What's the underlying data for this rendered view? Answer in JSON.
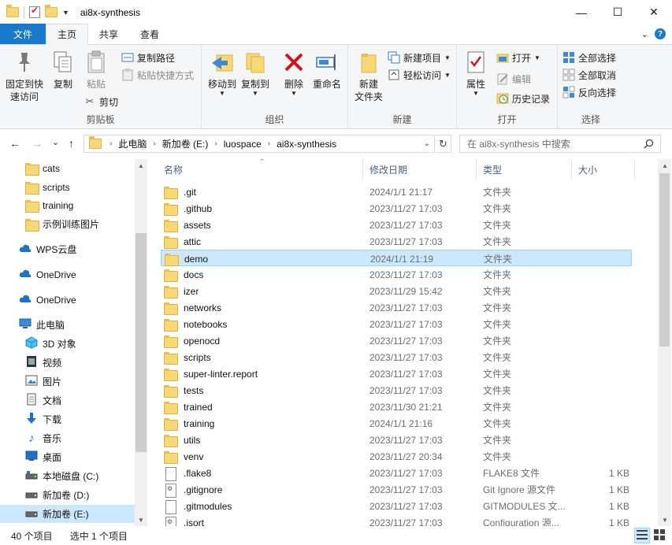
{
  "window": {
    "title": "ai8x-synthesis",
    "minimize": "—",
    "maximize": "☐",
    "close": "✕"
  },
  "ribbon_tabs": {
    "file": "文件",
    "home": "主页",
    "share": "共享",
    "view": "查看"
  },
  "ribbon": {
    "clipboard": {
      "label": "剪贴板",
      "pin_line1": "固定到快",
      "pin_line2": "速访问",
      "copy": "复制",
      "paste": "粘贴",
      "copy_path": "复制路径",
      "paste_shortcut": "粘贴快捷方式",
      "cut": "剪切"
    },
    "organize": {
      "label": "组织",
      "move_to": "移动到",
      "copy_to": "复制到",
      "delete": "删除",
      "rename": "重命名"
    },
    "new": {
      "label": "新建",
      "new_folder_line1": "新建",
      "new_folder_line2": "文件夹",
      "new_item": "新建项目",
      "easy_access": "轻松访问"
    },
    "open": {
      "label": "打开",
      "properties": "属性",
      "open": "打开",
      "edit": "编辑",
      "history": "历史记录"
    },
    "select": {
      "label": "选择",
      "select_all": "全部选择",
      "select_none": "全部取消",
      "invert": "反向选择"
    }
  },
  "address": {
    "back": "←",
    "forward": "→",
    "recent": "⌄",
    "up": "↑",
    "crumbs": [
      "此电脑",
      "新加卷 (E:)",
      "luospace",
      "ai8x-synthesis"
    ],
    "search_placeholder": "在 ai8x-synthesis 中搜索"
  },
  "nav": {
    "items": [
      {
        "label": "cats",
        "icon": "folder-icon"
      },
      {
        "label": "scripts",
        "icon": "folder-icon"
      },
      {
        "label": "training",
        "icon": "folder-icon"
      },
      {
        "label": "示例训练图片",
        "icon": "folder-icon"
      },
      {
        "label": "WPS云盘",
        "icon": "cloud-icon"
      },
      {
        "label": "OneDrive",
        "icon": "cloud-icon"
      },
      {
        "label": "OneDrive",
        "icon": "cloud-icon"
      },
      {
        "label": "此电脑",
        "icon": "computer-icon"
      },
      {
        "label": "3D 对象",
        "icon": "cube-icon"
      },
      {
        "label": "视频",
        "icon": "video-icon"
      },
      {
        "label": "图片",
        "icon": "picture-icon"
      },
      {
        "label": "文档",
        "icon": "document-icon"
      },
      {
        "label": "下载",
        "icon": "download-icon"
      },
      {
        "label": "音乐",
        "icon": "music-icon"
      },
      {
        "label": "桌面",
        "icon": "desktop-icon"
      },
      {
        "label": "本地磁盘 (C:)",
        "icon": "drive-icon"
      },
      {
        "label": "新加卷 (D:)",
        "icon": "drive-icon"
      },
      {
        "label": "新加卷 (E:)",
        "icon": "drive-icon"
      }
    ]
  },
  "columns": {
    "name": "名称",
    "date": "修改日期",
    "type": "类型",
    "size": "大小"
  },
  "files": [
    {
      "name": ".git",
      "date": "2024/1/1 21:17",
      "type": "文件夹",
      "size": "",
      "kind": "folder"
    },
    {
      "name": ".github",
      "date": "2023/11/27 17:03",
      "type": "文件夹",
      "size": "",
      "kind": "folder"
    },
    {
      "name": "assets",
      "date": "2023/11/27 17:03",
      "type": "文件夹",
      "size": "",
      "kind": "folder"
    },
    {
      "name": "attic",
      "date": "2023/11/27 17:03",
      "type": "文件夹",
      "size": "",
      "kind": "folder"
    },
    {
      "name": "demo",
      "date": "2024/1/1 21:19",
      "type": "文件夹",
      "size": "",
      "kind": "folder"
    },
    {
      "name": "docs",
      "date": "2023/11/27 17:03",
      "type": "文件夹",
      "size": "",
      "kind": "folder"
    },
    {
      "name": "izer",
      "date": "2023/11/29 15:42",
      "type": "文件夹",
      "size": "",
      "kind": "folder"
    },
    {
      "name": "networks",
      "date": "2023/11/27 17:03",
      "type": "文件夹",
      "size": "",
      "kind": "folder"
    },
    {
      "name": "notebooks",
      "date": "2023/11/27 17:03",
      "type": "文件夹",
      "size": "",
      "kind": "folder"
    },
    {
      "name": "openocd",
      "date": "2023/11/27 17:03",
      "type": "文件夹",
      "size": "",
      "kind": "folder"
    },
    {
      "name": "scripts",
      "date": "2023/11/27 17:03",
      "type": "文件夹",
      "size": "",
      "kind": "folder"
    },
    {
      "name": "super-linter.report",
      "date": "2023/11/27 17:03",
      "type": "文件夹",
      "size": "",
      "kind": "folder"
    },
    {
      "name": "tests",
      "date": "2023/11/27 17:03",
      "type": "文件夹",
      "size": "",
      "kind": "folder"
    },
    {
      "name": "trained",
      "date": "2023/11/30 21:21",
      "type": "文件夹",
      "size": "",
      "kind": "folder"
    },
    {
      "name": "training",
      "date": "2024/1/1 21:16",
      "type": "文件夹",
      "size": "",
      "kind": "folder"
    },
    {
      "name": "utils",
      "date": "2023/11/27 17:03",
      "type": "文件夹",
      "size": "",
      "kind": "folder"
    },
    {
      "name": "venv",
      "date": "2023/11/27 20:34",
      "type": "文件夹",
      "size": "",
      "kind": "folder"
    },
    {
      "name": ".flake8",
      "date": "2023/11/27 17:03",
      "type": "FLAKE8 文件",
      "size": "1 KB",
      "kind": "file"
    },
    {
      "name": ".gitignore",
      "date": "2023/11/27 17:03",
      "type": "Git Ignore 源文件",
      "size": "1 KB",
      "kind": "gear"
    },
    {
      "name": ".gitmodules",
      "date": "2023/11/27 17:03",
      "type": "GITMODULES 文...",
      "size": "1 KB",
      "kind": "file"
    },
    {
      "name": ".isort",
      "date": "2023/11/27 17:03",
      "type": "Configuration 源...",
      "size": "1 KB",
      "kind": "gear"
    }
  ],
  "status": {
    "count": "40 个项目",
    "selected": "选中 1 个项目"
  }
}
